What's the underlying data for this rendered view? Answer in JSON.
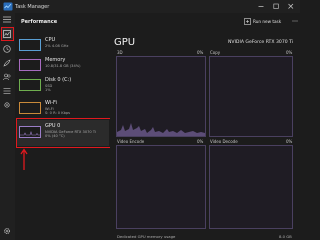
{
  "window": {
    "title": "Task Manager"
  },
  "header": {
    "title": "Performance",
    "run_task": "Run new task"
  },
  "devices": [
    {
      "name": "CPU",
      "sub": "2% 4.08 GHz"
    },
    {
      "name": "Memory",
      "sub": "10.8/31.8 GB (34%)"
    },
    {
      "name": "Disk 0 (C:)",
      "sub": "SSD\n1%"
    },
    {
      "name": "Wi-Fi",
      "sub": "Wi-Fi\nS: 0 R: 0 Kbps"
    },
    {
      "name": "GPU 0",
      "sub": "NVIDIA GeForce RTX 3070 Ti\n0% (40 °C)"
    }
  ],
  "main": {
    "title": "GPU",
    "model": "NVIDIA GeForce RTX 3070 Ti",
    "graphs": [
      {
        "label": "3D",
        "pct": "0%"
      },
      {
        "label": "Copy",
        "pct": "0%"
      },
      {
        "label": "Video Encode",
        "pct": "0%"
      },
      {
        "label": "Video Decode",
        "pct": "0%"
      }
    ],
    "footer_label": "Dedicated GPU memory usage",
    "footer_value": "8.0 GB"
  },
  "colors": {
    "accent": "#9b7ec8",
    "highlight": "#e0191e",
    "cpu_border": "#5a9fd4"
  }
}
